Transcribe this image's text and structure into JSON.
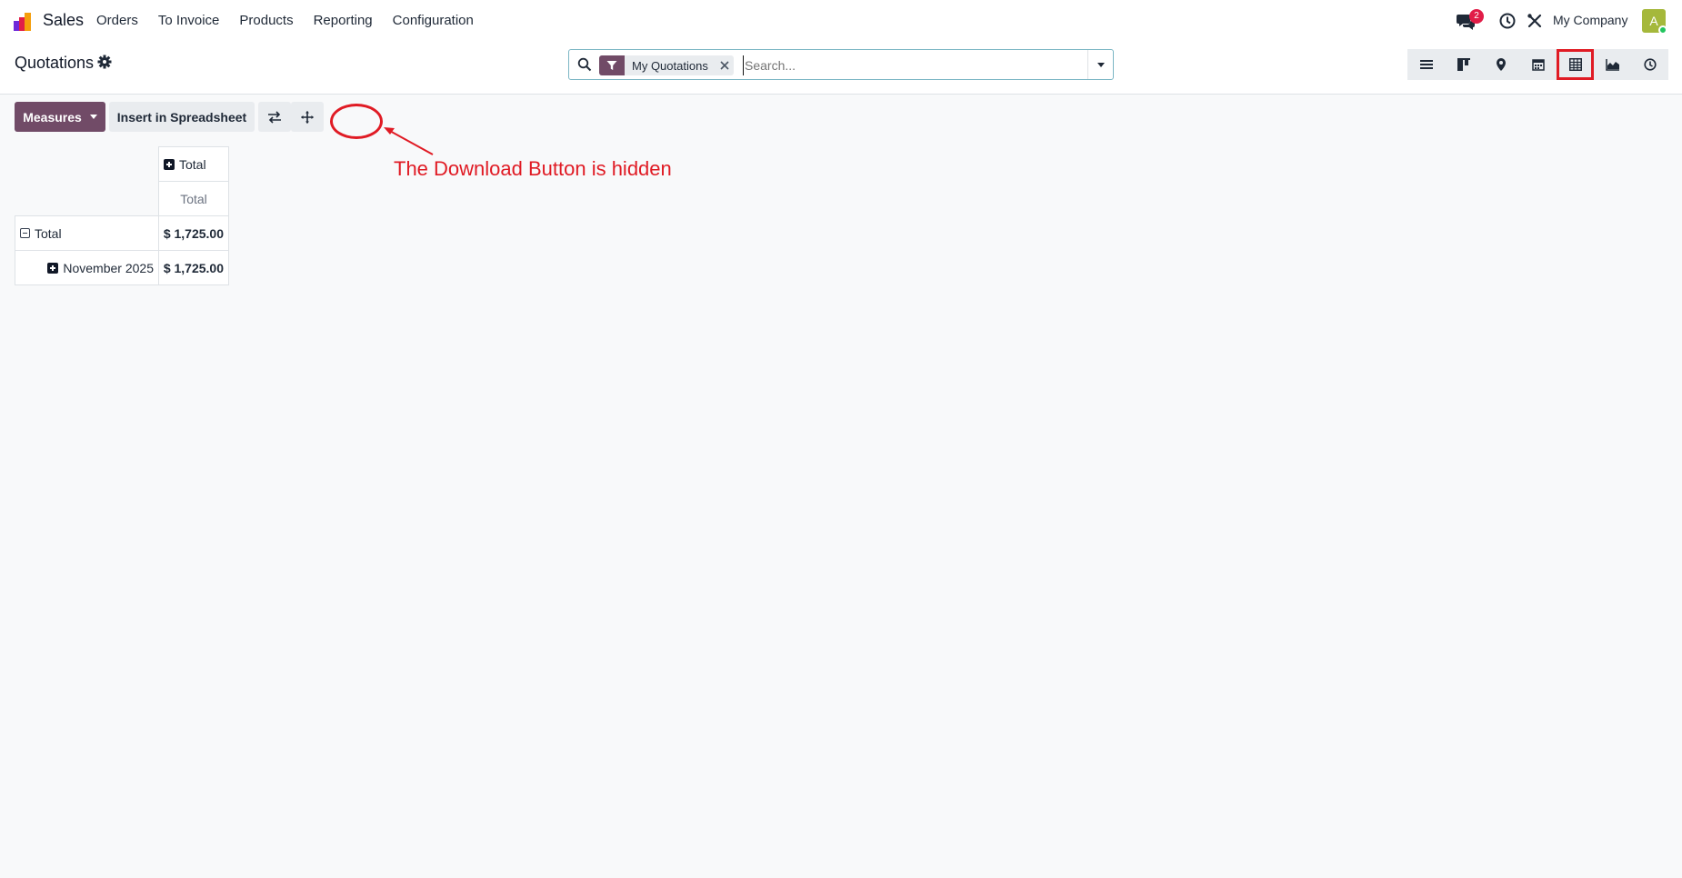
{
  "navbar": {
    "app_name": "Sales",
    "menu": [
      "Orders",
      "To Invoice",
      "Products",
      "Reporting",
      "Configuration"
    ],
    "messages_count": "2",
    "company": "My Company",
    "avatar_initial": "A"
  },
  "control_panel": {
    "breadcrumb": "Quotations",
    "search": {
      "facet": "My Quotations",
      "placeholder": "Search..."
    },
    "views": [
      "list-icon",
      "kanban-icon",
      "map-icon",
      "calendar-icon",
      "pivot-icon",
      "graph-icon",
      "activity-icon"
    ],
    "active_view": "pivot-icon"
  },
  "actions": {
    "measures": "Measures",
    "insert_spreadsheet": "Insert in Spreadsheet"
  },
  "annotation": {
    "text": "The Download Button is hidden"
  },
  "pivot": {
    "col_header": "Total",
    "col_measure": "Total",
    "rows": [
      {
        "label": "Total",
        "value": "$ 1,725.00"
      },
      {
        "label": "November 2025",
        "value": "$ 1,725.00"
      }
    ]
  },
  "colors": {
    "brand": "#714b67",
    "annotation": "#e01b24"
  }
}
